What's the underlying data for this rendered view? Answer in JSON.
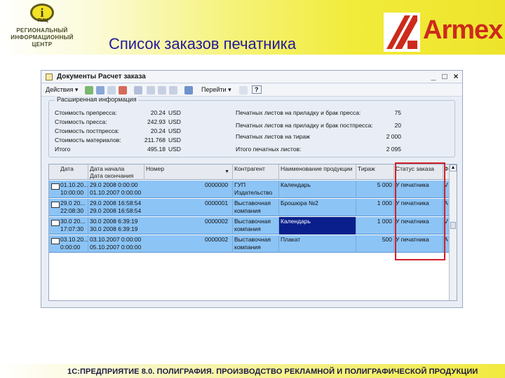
{
  "header": {
    "logo_symbol": "i",
    "logo_abbr": "РИЦ",
    "logo_lines": [
      "РЕГИОНАЛЬНЫЙ",
      "ИНФОРМАЦИОННЫЙ",
      "ЦЕНТР"
    ],
    "title": "Список заказов печатника",
    "brand": "Armex"
  },
  "window": {
    "title": "Документы Расчет заказа",
    "controls": [
      "_",
      "□",
      "×"
    ]
  },
  "toolbar": {
    "actions_label": "Действия ▾",
    "goto_label": "Перейти ▾",
    "help_label": "?"
  },
  "extended_info": {
    "title": "Расширенная информация",
    "left": [
      {
        "label": "Стоимость препресса:",
        "value": "20.24",
        "unit": "USD"
      },
      {
        "label": "Стоимость пресса:",
        "value": "242.93",
        "unit": "USD"
      },
      {
        "label": "Стоимость постпресса:",
        "value": "20.24",
        "unit": "USD"
      },
      {
        "label": "Стоимость материалов:",
        "value": "211.768",
        "unit": "USD"
      },
      {
        "label": "Итого",
        "value": "495.18",
        "unit": "USD"
      }
    ],
    "right": [
      {
        "label": "Печатных листов на приладку и брак пресса:",
        "value": "75"
      },
      {
        "label": "Печатных листов на приладку и брак постпресса:",
        "value": "20"
      },
      {
        "label": "Печатных листов на тираж",
        "value": "2 000"
      },
      {
        "label": "Итого печатных листов:",
        "value": "2 095"
      }
    ]
  },
  "table": {
    "columns": [
      "Дата",
      "Дата начала\nДата окончания",
      "Номер",
      "Контрагент",
      "Наименование продукции",
      "Тираж",
      "Статус заказа",
      "Ф"
    ],
    "rows": [
      {
        "date1": "01.10.20...",
        "date2": "10:00:00",
        "start": "29.0  2008 0:00:00",
        "end": "01.10.2007 0:00:00",
        "number": "0000000",
        "contractor": "ГУП\nИздательство",
        "product": "Календарь",
        "qty": "5 000",
        "status": "У печатника",
        "f": "V"
      },
      {
        "date1": "29.0 20...",
        "date2": "22:08:30",
        "start": "29.0  2008 16:58:54",
        "end": "29.0  2008 16:58:54",
        "number": "0000001",
        "contractor": "Выставочная\nкомпания",
        "product": "Брошюра №2",
        "qty": "1 000",
        "status": "У печатника",
        "f": "A"
      },
      {
        "date1": "30.0  20...",
        "date2": "17:07:30",
        "start": "30.0  2008 6:39:19",
        "end": "30.0  2008 6:39:19",
        "number": "0000002",
        "contractor": "Выставочная\nкомпания",
        "product": "Календарь",
        "qty": "1 000",
        "status": "У печатника",
        "f": "V"
      },
      {
        "date1": "03.10.20...",
        "date2": "0:00:00",
        "start": "03.10.2007 0:00:00",
        "end": "05.10.2007 0:00:00",
        "number": "0000002",
        "contractor": "Выставочная\nкомпания",
        "product": "Плакат",
        "qty": "500",
        "status": "У печатника",
        "f": "A"
      }
    ]
  },
  "footer": {
    "text": "1С:ПРЕДПРИЯТИЕ 8.0. ПОЛИГРАФИЯ. ПРОИЗВОДСТВО РЕКЛАМНОЙ И ПОЛИГРАФИЧЕСКОЙ ПРОДУКЦИИ"
  },
  "colors": {
    "title": "#221a9c",
    "brand": "#cc2a1c",
    "row_bg": "#8cc4f6",
    "selected_cell": "#0a1f8c",
    "highlight_box": "#d0202a"
  }
}
